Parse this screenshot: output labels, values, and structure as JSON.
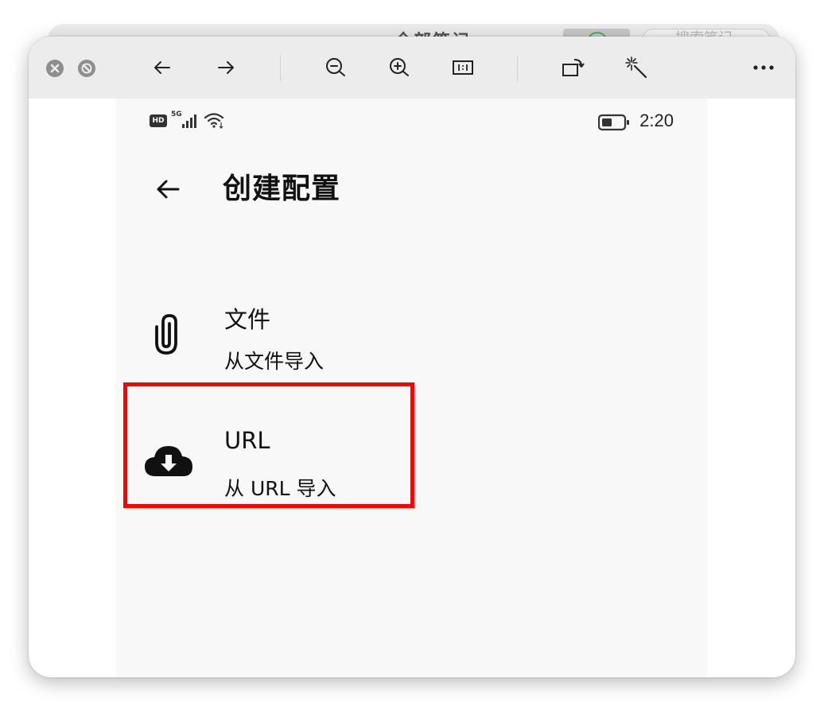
{
  "background_window": {
    "title": "全部笔记",
    "search_placeholder": "搜索笔记"
  },
  "toolbar": {
    "buttons": [
      {
        "name": "back-icon"
      },
      {
        "name": "forward-icon"
      },
      {
        "name": "zoom-out-icon"
      },
      {
        "name": "zoom-in-icon"
      },
      {
        "name": "actual-size-icon"
      },
      {
        "name": "rotate-icon"
      },
      {
        "name": "magic-wand-icon"
      },
      {
        "name": "more-icon"
      }
    ]
  },
  "status_bar": {
    "hd": "HD",
    "network": "5G",
    "time": "2:20"
  },
  "page": {
    "title": "创建配置",
    "back_icon": "arrow-left-icon"
  },
  "items": [
    {
      "icon": "paperclip-icon",
      "title": "文件",
      "subtitle": "从文件导入"
    },
    {
      "icon": "cloud-download-icon",
      "title": "URL",
      "subtitle": "从 URL 导入"
    }
  ],
  "colors": {
    "highlight": "#ff0000",
    "toolbar_bg": "#ececec",
    "screen_bg": "#f8f8f8"
  }
}
